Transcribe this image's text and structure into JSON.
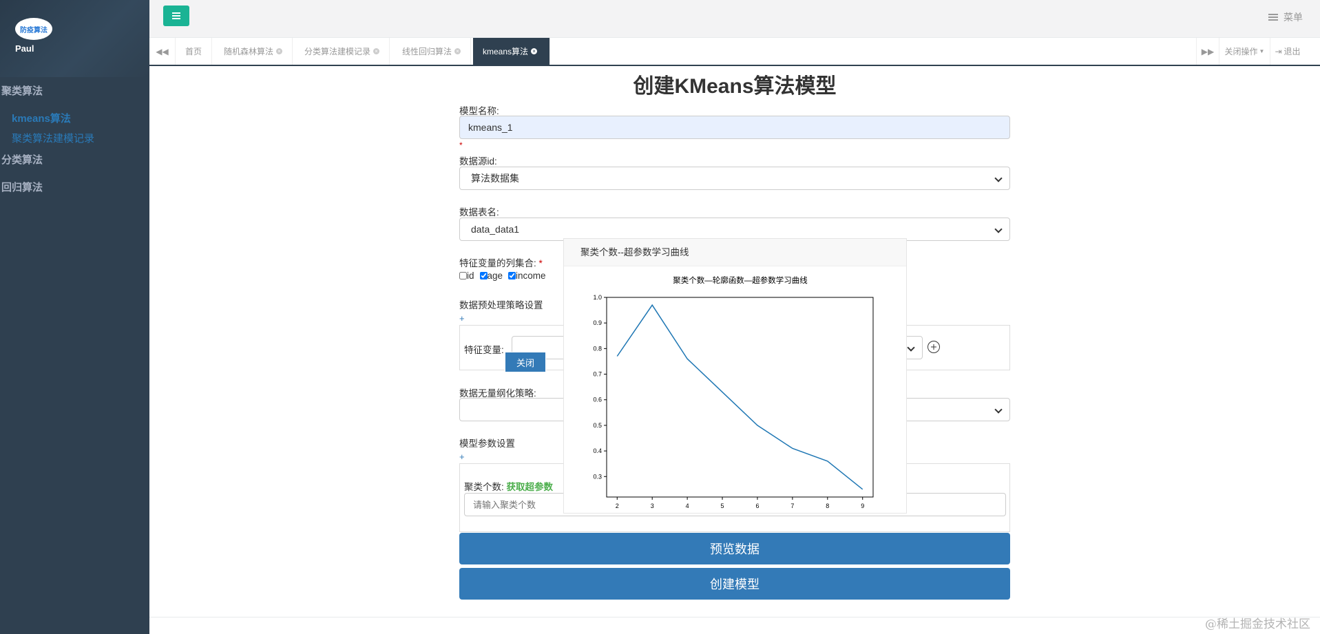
{
  "sidebar": {
    "logo_text": "防疫算法",
    "username": "Paul",
    "groups": [
      {
        "label": "聚类算法",
        "items": [
          "kmeans算法",
          "聚类算法建模记录"
        ]
      },
      {
        "label": "分类算法"
      },
      {
        "label": "回归算法"
      }
    ]
  },
  "topbar": {
    "menu_label": "菜单"
  },
  "tabs": {
    "items": [
      "首页",
      "随机森林算法",
      "分类算法建模记录",
      "线性回归算法",
      "kmeans算法"
    ],
    "active_index": 4,
    "close_ops": "关闭操作",
    "logout": "退出"
  },
  "form": {
    "title": "创建KMeans算法模型",
    "model_name_label": "模型名称:",
    "model_name_value": "kmeans_1",
    "required_mark": "*",
    "source_label": "数据源id:",
    "source_value": "算法数据集",
    "table_label": "数据表名:",
    "table_value": "data_data1",
    "features_label": "特征变量的列集合:",
    "features": [
      {
        "name": "id",
        "checked": false
      },
      {
        "name": "age",
        "checked": true
      },
      {
        "name": "income",
        "checked": true
      }
    ],
    "preprocess_label": "数据预处理策略设置",
    "plus": "+",
    "feature_var_label": "特征变量:",
    "scaling_label": "数据无量纲化策略:",
    "params_label": "模型参数设置",
    "k_label": "聚类个数:",
    "k_link": "获取超参数",
    "k_placeholder": "请输入聚类个数",
    "preview_button": "预览数据",
    "create_button": "创建模型"
  },
  "dialog": {
    "title": "聚类个数--超参数学习曲线",
    "close_label": "关闭"
  },
  "chart_data": {
    "type": "line",
    "title": "聚类个数—轮廓函数—超参数学习曲线",
    "x": [
      2,
      3,
      4,
      5,
      6,
      7,
      8,
      9
    ],
    "series": [
      {
        "values": [
          0.77,
          0.97,
          0.76,
          0.63,
          0.5,
          0.41,
          0.36,
          0.25
        ]
      }
    ],
    "xlim": [
      1.7,
      9.3
    ],
    "ylim": [
      0.22,
      1.0
    ],
    "xticks": [
      "2",
      "3",
      "4",
      "5",
      "6",
      "7",
      "8",
      "9"
    ],
    "yticks": [
      "0.3",
      "0.4",
      "0.5",
      "0.6",
      "0.7",
      "0.8",
      "0.9",
      "1.0"
    ],
    "line_color": "#1f77b4",
    "xlabel": "",
    "ylabel": ""
  },
  "watermark": "@稀土掘金技术社区"
}
